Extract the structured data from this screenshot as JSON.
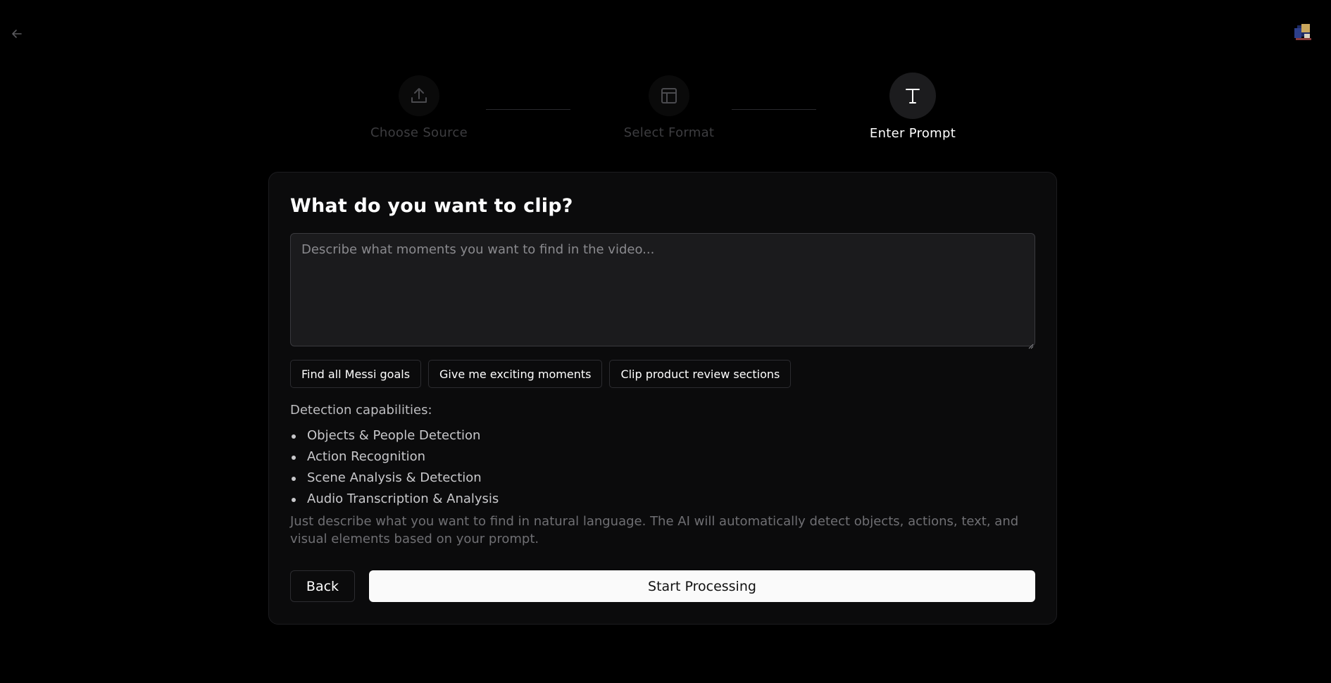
{
  "nav": {
    "back_icon": "arrow-left-icon",
    "avatar_icon": "user-avatar-icon"
  },
  "steps": [
    {
      "label": "Choose Source",
      "icon": "upload-icon",
      "active": false
    },
    {
      "label": "Select Format",
      "icon": "layout-icon",
      "active": false
    },
    {
      "label": "Enter Prompt",
      "icon": "text-t-icon",
      "active": true
    }
  ],
  "card": {
    "title": "What do you want to clip?",
    "prompt": {
      "value": "",
      "placeholder": "Describe what moments you want to find in the video..."
    },
    "suggestions": [
      "Find all Messi goals",
      "Give me exciting moments",
      "Clip product review sections"
    ],
    "capabilities_heading": "Detection capabilities:",
    "capabilities": [
      "Objects & People Detection",
      "Action Recognition",
      "Scene Analysis & Detection",
      "Audio Transcription & Analysis"
    ],
    "hint": "Just describe what you want to find in natural language. The AI will automatically detect objects, actions, text, and visual elements based on your prompt.",
    "back_label": "Back",
    "start_label": "Start Processing"
  },
  "colors": {
    "background": "#000000",
    "card": "#0b0b0c",
    "primary_button": "#fafafa",
    "inactive_step": "#3d3d40"
  }
}
